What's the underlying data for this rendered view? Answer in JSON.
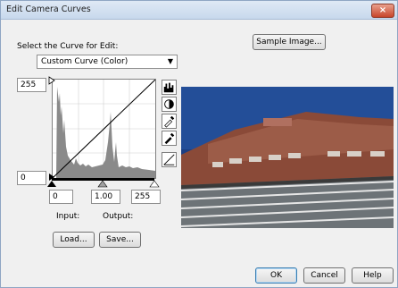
{
  "window": {
    "title": "Edit Camera Curves",
    "close_label": "×"
  },
  "curve_select": {
    "label": "Select the Curve for Edit:",
    "value": "Custom Curve (Color)",
    "arrow": "▼"
  },
  "sample_button": "Sample Image...",
  "axis": {
    "top_value": "255",
    "bottom_value": "0"
  },
  "inputs": {
    "left": "0",
    "mid": "1.00",
    "right": "255"
  },
  "labels": {
    "input": "Input:",
    "output": "Output:"
  },
  "buttons": {
    "load": "Load...",
    "save": "Save...",
    "ok": "OK",
    "cancel": "Cancel",
    "help": "Help"
  },
  "tools": [
    "histogram-icon",
    "contrast-icon",
    "eyedropper-black-icon",
    "eyedropper-white-icon",
    "curve-reset-icon"
  ]
}
